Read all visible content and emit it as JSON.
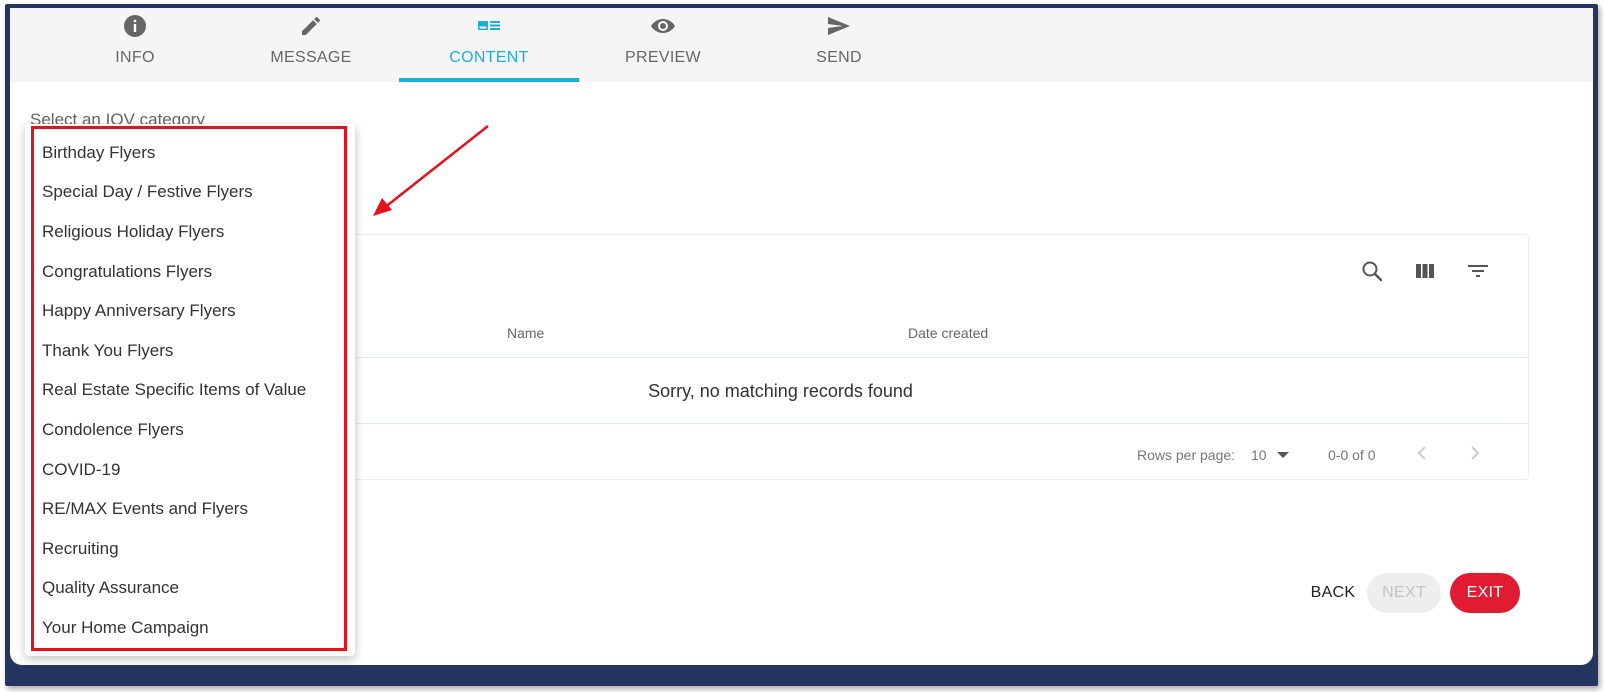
{
  "tabs": [
    {
      "label": "INFO",
      "icon": "info-icon",
      "active": false
    },
    {
      "label": "MESSAGE",
      "icon": "pencil-icon",
      "active": false
    },
    {
      "label": "CONTENT",
      "icon": "content-card-icon",
      "active": true
    },
    {
      "label": "PREVIEW",
      "icon": "eye-icon",
      "active": false
    },
    {
      "label": "SEND",
      "icon": "send-icon",
      "active": false
    }
  ],
  "content": {
    "select_label": "Select an IOV category"
  },
  "dropdown": {
    "items": [
      "Birthday Flyers",
      "Special Day / Festive Flyers",
      "Religious Holiday Flyers",
      "Congratulations Flyers",
      "Happy Anniversary Flyers",
      "Thank You Flyers",
      "Real Estate Specific Items of Value",
      "Condolence Flyers",
      "COVID-19",
      "RE/MAX Events and Flyers",
      "Recruiting",
      "Quality Assurance",
      "Your Home Campaign"
    ]
  },
  "table": {
    "toolbar_icons": [
      "search-icon",
      "view-columns-icon",
      "filter-icon"
    ],
    "columns": [
      "Name",
      "Date created"
    ],
    "empty_message": "Sorry, no matching records found",
    "pagination": {
      "rows_per_page_label": "Rows per page:",
      "rows_per_page_value": "10",
      "range_text": "0-0 of 0"
    }
  },
  "actions": {
    "back": "BACK",
    "next": "NEXT",
    "exit": "EXIT"
  },
  "colors": {
    "accent": "#1ab0d6",
    "exit": "#e11c32",
    "frame": "#24355f",
    "highlight": "#e8101a"
  }
}
